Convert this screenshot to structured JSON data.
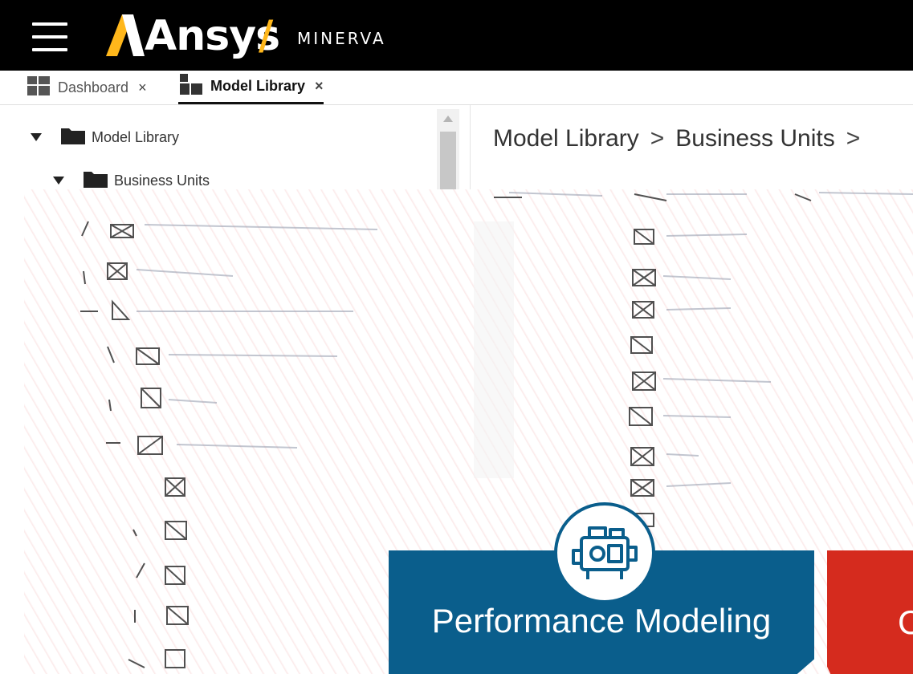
{
  "header": {
    "brand": "Ansys",
    "separator": "/",
    "product": "MINERVA",
    "menu_icon": "hamburger-menu-icon",
    "brand_color": "#ffb71b"
  },
  "tabs": [
    {
      "label": "Dashboard",
      "icon": "dashboard-icon",
      "close": "×",
      "active": false
    },
    {
      "label": "Model Library",
      "icon": "model-library-icon",
      "close": "×",
      "active": true
    }
  ],
  "tree": {
    "items": [
      {
        "label": "Model Library",
        "icon": "folder-icon",
        "expanded": true
      },
      {
        "label": "Business Units",
        "icon": "folder-icon",
        "expanded": true
      }
    ]
  },
  "breadcrumb": {
    "items": [
      "Model Library",
      "Business Units"
    ],
    "separator": ">"
  },
  "cards": [
    {
      "title": "Performance Modeling",
      "color": "#0a5e8c",
      "icon": "engine-icon"
    },
    {
      "title": "C",
      "color": "#d52b1e"
    }
  ]
}
